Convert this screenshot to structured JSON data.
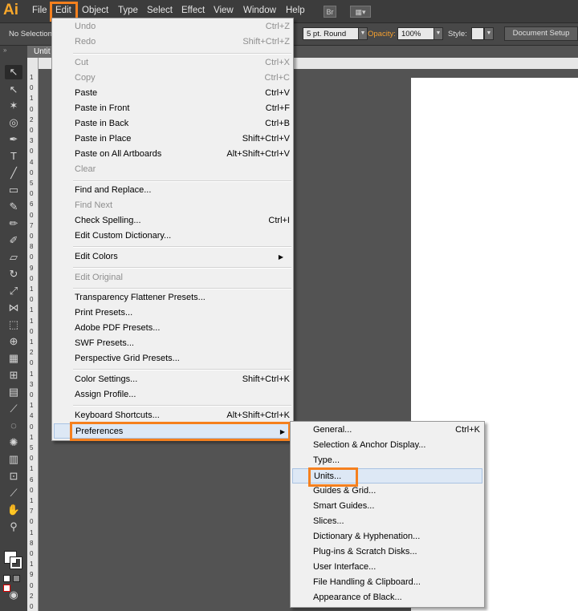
{
  "app": {
    "logo": "Ai"
  },
  "menubar": {
    "items": [
      "File",
      "Edit",
      "Object",
      "Type",
      "Select",
      "Effect",
      "View",
      "Window",
      "Help"
    ],
    "bridge_button": "Br"
  },
  "controlbar": {
    "selection": "No Selection",
    "brush": "5 pt. Round",
    "opacity_label": "Opacity:",
    "opacity_value": "100%",
    "style_label": "Style:",
    "document_setup": "Document Setup"
  },
  "document": {
    "tab": "Untit"
  },
  "edit_menu": {
    "undo": {
      "label": "Undo",
      "shortcut": "Ctrl+Z"
    },
    "redo": {
      "label": "Redo",
      "shortcut": "Shift+Ctrl+Z"
    },
    "cut": {
      "label": "Cut",
      "shortcut": "Ctrl+X"
    },
    "copy": {
      "label": "Copy",
      "shortcut": "Ctrl+C"
    },
    "paste": {
      "label": "Paste",
      "shortcut": "Ctrl+V"
    },
    "paste_front": {
      "label": "Paste in Front",
      "shortcut": "Ctrl+F"
    },
    "paste_back": {
      "label": "Paste in Back",
      "shortcut": "Ctrl+B"
    },
    "paste_place": {
      "label": "Paste in Place",
      "shortcut": "Shift+Ctrl+V"
    },
    "paste_artboards": {
      "label": "Paste on All Artboards",
      "shortcut": "Alt+Shift+Ctrl+V"
    },
    "clear": {
      "label": "Clear"
    },
    "find_replace": {
      "label": "Find and Replace..."
    },
    "find_next": {
      "label": "Find Next"
    },
    "check_spelling": {
      "label": "Check Spelling...",
      "shortcut": "Ctrl+I"
    },
    "edit_dictionary": {
      "label": "Edit Custom Dictionary..."
    },
    "edit_colors": {
      "label": "Edit Colors"
    },
    "edit_original": {
      "label": "Edit Original"
    },
    "transparency_presets": {
      "label": "Transparency Flattener Presets..."
    },
    "print_presets": {
      "label": "Print Presets..."
    },
    "pdf_presets": {
      "label": "Adobe PDF Presets..."
    },
    "swf_presets": {
      "label": "SWF Presets..."
    },
    "perspective_presets": {
      "label": "Perspective Grid Presets..."
    },
    "color_settings": {
      "label": "Color Settings...",
      "shortcut": "Shift+Ctrl+K"
    },
    "assign_profile": {
      "label": "Assign Profile..."
    },
    "keyboard_shortcuts": {
      "label": "Keyboard Shortcuts...",
      "shortcut": "Alt+Shift+Ctrl+K"
    },
    "preferences": {
      "label": "Preferences"
    }
  },
  "preferences_menu": {
    "general": {
      "label": "General...",
      "shortcut": "Ctrl+K"
    },
    "selection_anchor": {
      "label": "Selection & Anchor Display..."
    },
    "type": {
      "label": "Type..."
    },
    "units": {
      "label": "Units..."
    },
    "guides_grid": {
      "label": "Guides & Grid..."
    },
    "smart_guides": {
      "label": "Smart Guides..."
    },
    "slices": {
      "label": "Slices..."
    },
    "dictionary": {
      "label": "Dictionary & Hyphenation..."
    },
    "plugins": {
      "label": "Plug-ins & Scratch Disks..."
    },
    "user_interface": {
      "label": "User Interface..."
    },
    "file_handling": {
      "label": "File Handling & Clipboard..."
    },
    "appearance_black": {
      "label": "Appearance of Black..."
    }
  },
  "ruler": {
    "labels": [
      "1",
      "0",
      "1",
      "0",
      "2",
      "0",
      "3",
      "0",
      "4",
      "0",
      "5",
      "0",
      "6",
      "0",
      "7",
      "0",
      "8",
      "0",
      "9",
      "0",
      "1",
      "0",
      "1",
      "1",
      "0",
      "1",
      "2",
      "0",
      "1",
      "3",
      "0",
      "1",
      "4",
      "0",
      "1",
      "5",
      "0",
      "1",
      "6",
      "0",
      "1",
      "7",
      "0",
      "1",
      "8",
      "0",
      "1",
      "9",
      "0",
      "2",
      "0"
    ]
  },
  "colors": {
    "highlight": "#f5801e",
    "logo": "#f7a72b"
  }
}
